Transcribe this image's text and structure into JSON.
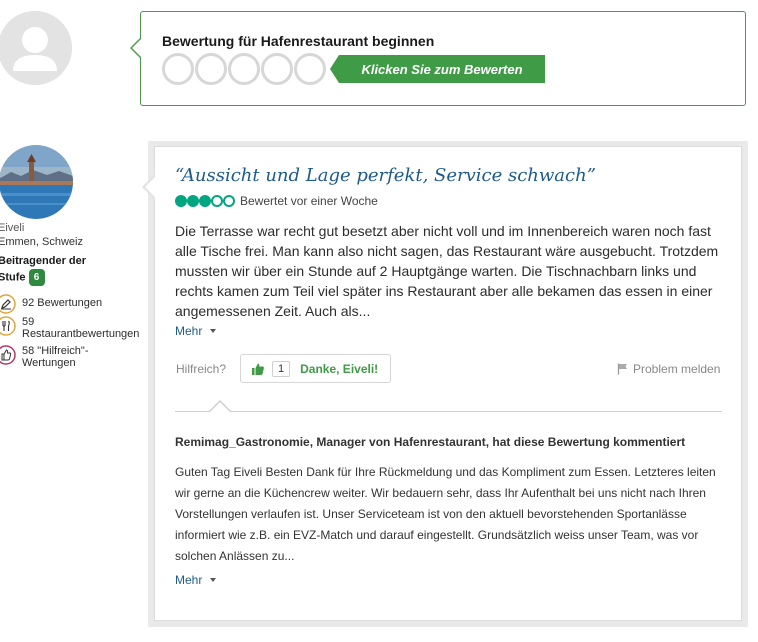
{
  "write_review": {
    "title": "Bewertung für Hafenrestaurant beginnen",
    "button_label": "Klicken Sie zum Bewerten"
  },
  "reviewer": {
    "name": "Eiveli",
    "location": "Emmen, Schweiz",
    "level_label": "Beitragender der Stufe",
    "level": "6",
    "stats": [
      {
        "icon": "pencil-icon",
        "text": "92 Bewertungen"
      },
      {
        "icon": "restaurant-icon",
        "text": "59 Restaurantbewertungen"
      },
      {
        "icon": "thumbs-up-icon",
        "text": "58 \"Hilfreich\"-Wertungen"
      }
    ]
  },
  "review": {
    "title": "“Aussicht und Lage perfekt, Service schwach”",
    "rating": 3,
    "rating_max": 5,
    "date_text": "Bewertet vor einer Woche",
    "body": "Die Terrasse war recht gut besetzt aber nicht voll und im Innenbereich waren noch fast alle Tische frei. Man kann also nicht sagen, das Restaurant wäre ausgebucht. Trotzdem mussten wir über ein Stunde auf 2 Hauptgänge warten. Die Tischnachbarn links und rechts kamen zum Teil viel später ins Restaurant aber alle bekamen das essen in einer angemessenen Zeit. Auch als...",
    "more_label": "Mehr",
    "helpful_label": "Hilfreich?",
    "thanks_count": "1",
    "thanks_label": "Danke, Eiveli!",
    "report_label": "Problem melden"
  },
  "management_response": {
    "title": "Remimag_Gastronomie, Manager von Hafenrestaurant, hat diese Bewertung kommentiert",
    "body": "Guten Tag Eiveli Besten Dank für Ihre Rückmeldung und das Kompliment zum Essen. Letzteres leiten wir gerne an die Küchencrew weiter. Wir bedauern sehr, dass Ihr Aufenthalt bei uns nicht nach Ihren Vorstellungen verlaufen ist. Unser Serviceteam ist von den aktuell bevorstehenden Sportanlässe informiert wie z.B. ein EVZ-Match und darauf eingestellt. Grundsätzlich weiss unser Team, was vor solchen Anlässen zu...",
    "more_label": "Mehr"
  },
  "colors": {
    "brand_green": "#3f9b45",
    "bubble_green": "#00a680",
    "link_blue": "#1d5b8f"
  }
}
